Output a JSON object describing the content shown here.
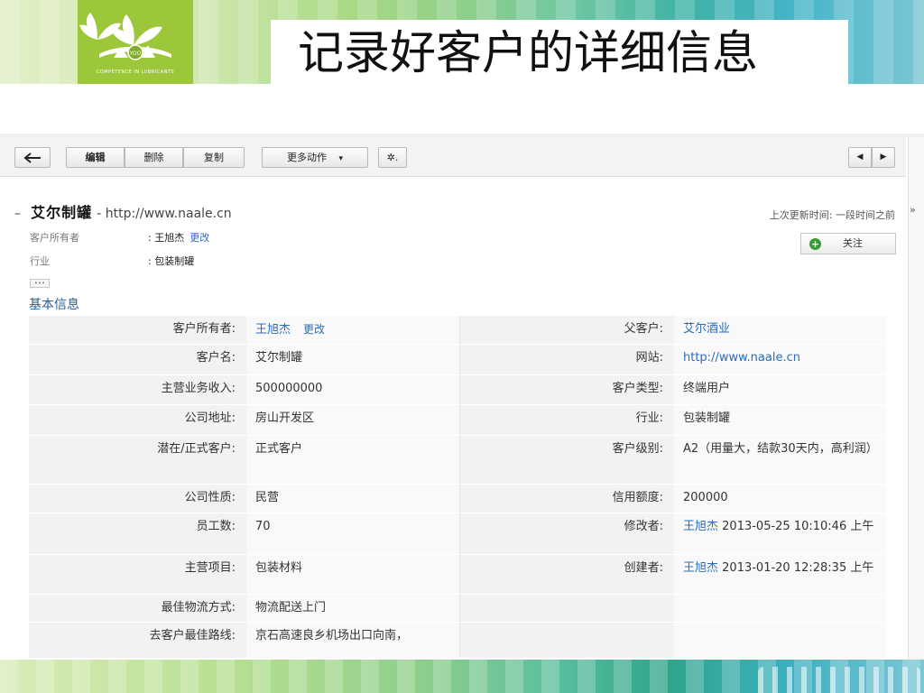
{
  "slide": {
    "title": "记录好客户的详细信息",
    "logo_tag": "COMPETENCE IN LUBRICANTS",
    "logo_badge": "YOO"
  },
  "toolbar": {
    "back_icon": "arrow-left-icon",
    "edit": "编辑",
    "delete": "删除",
    "copy": "复制",
    "more_actions": "更多动作",
    "more_actions_caret": "▾",
    "gear_menu": "✲.",
    "prev": "◀",
    "next": "▶"
  },
  "record": {
    "name": "艾尔制罐",
    "url_sep": " - ",
    "url": "http://www.naale.cn",
    "last_updated": "上次更新时间: 一段时间之前",
    "follow": "关注",
    "summary": [
      {
        "label": "客户所有者",
        "value": "王旭杰",
        "edit": "更改"
      },
      {
        "label": "行业",
        "value": "包装制罐",
        "edit": ""
      }
    ],
    "more": "•••",
    "side_expand": "»"
  },
  "section": {
    "title": "基本信息"
  },
  "details": {
    "rows": [
      {
        "l1": "客户所有者:",
        "v1": "王旭杰",
        "e1": "更改",
        "l2": "父客户:",
        "v2": "艾尔酒业",
        "t2": ""
      },
      {
        "l1": "客户名:",
        "v1": "艾尔制罐",
        "e1": "",
        "l2": "网站:",
        "v2": "http://www.naale.cn",
        "t2": ""
      },
      {
        "l1": "主营业务收入:",
        "v1": "500000000",
        "e1": "",
        "l2": "客户类型:",
        "v2": "终端用户",
        "t2": ""
      },
      {
        "l1": "公司地址:",
        "v1": "房山开发区",
        "e1": "",
        "l2": "行业:",
        "v2": "包装制罐",
        "t2": ""
      },
      {
        "l1": "潜在/正式客户:",
        "v1": "正式客户",
        "e1": "",
        "l2": "客户级别:",
        "v2": "A2（用量大，结款30天内，高利润）",
        "t2": ""
      },
      {
        "l1": "公司性质:",
        "v1": "民营",
        "e1": "",
        "l2": "信用额度:",
        "v2": "200000",
        "t2": ""
      },
      {
        "l1": "员工数:",
        "v1": "70",
        "e1": "",
        "l2": "修改者:",
        "v2": "王旭杰",
        "t2": " 2013-05-25 10:10:46 上午"
      },
      {
        "l1": "主营项目:",
        "v1": "包装材料",
        "e1": "",
        "l2": "创建者:",
        "v2": "王旭杰",
        "t2": " 2013-01-20 12:28:35 上午"
      },
      {
        "l1": "最佳物流方式:",
        "v1": "物流配送上门",
        "e1": "",
        "l2": "",
        "v2": "",
        "t2": ""
      },
      {
        "l1": "去客户最佳路线:",
        "v1": "京石高速良乡机场出口向南，",
        "e1": "",
        "l2": "",
        "v2": "",
        "t2": ""
      }
    ]
  },
  "colors": {
    "link": "#2a6dbd",
    "section_title": "#2a5e9e",
    "logo_green": "#9cc73a"
  }
}
